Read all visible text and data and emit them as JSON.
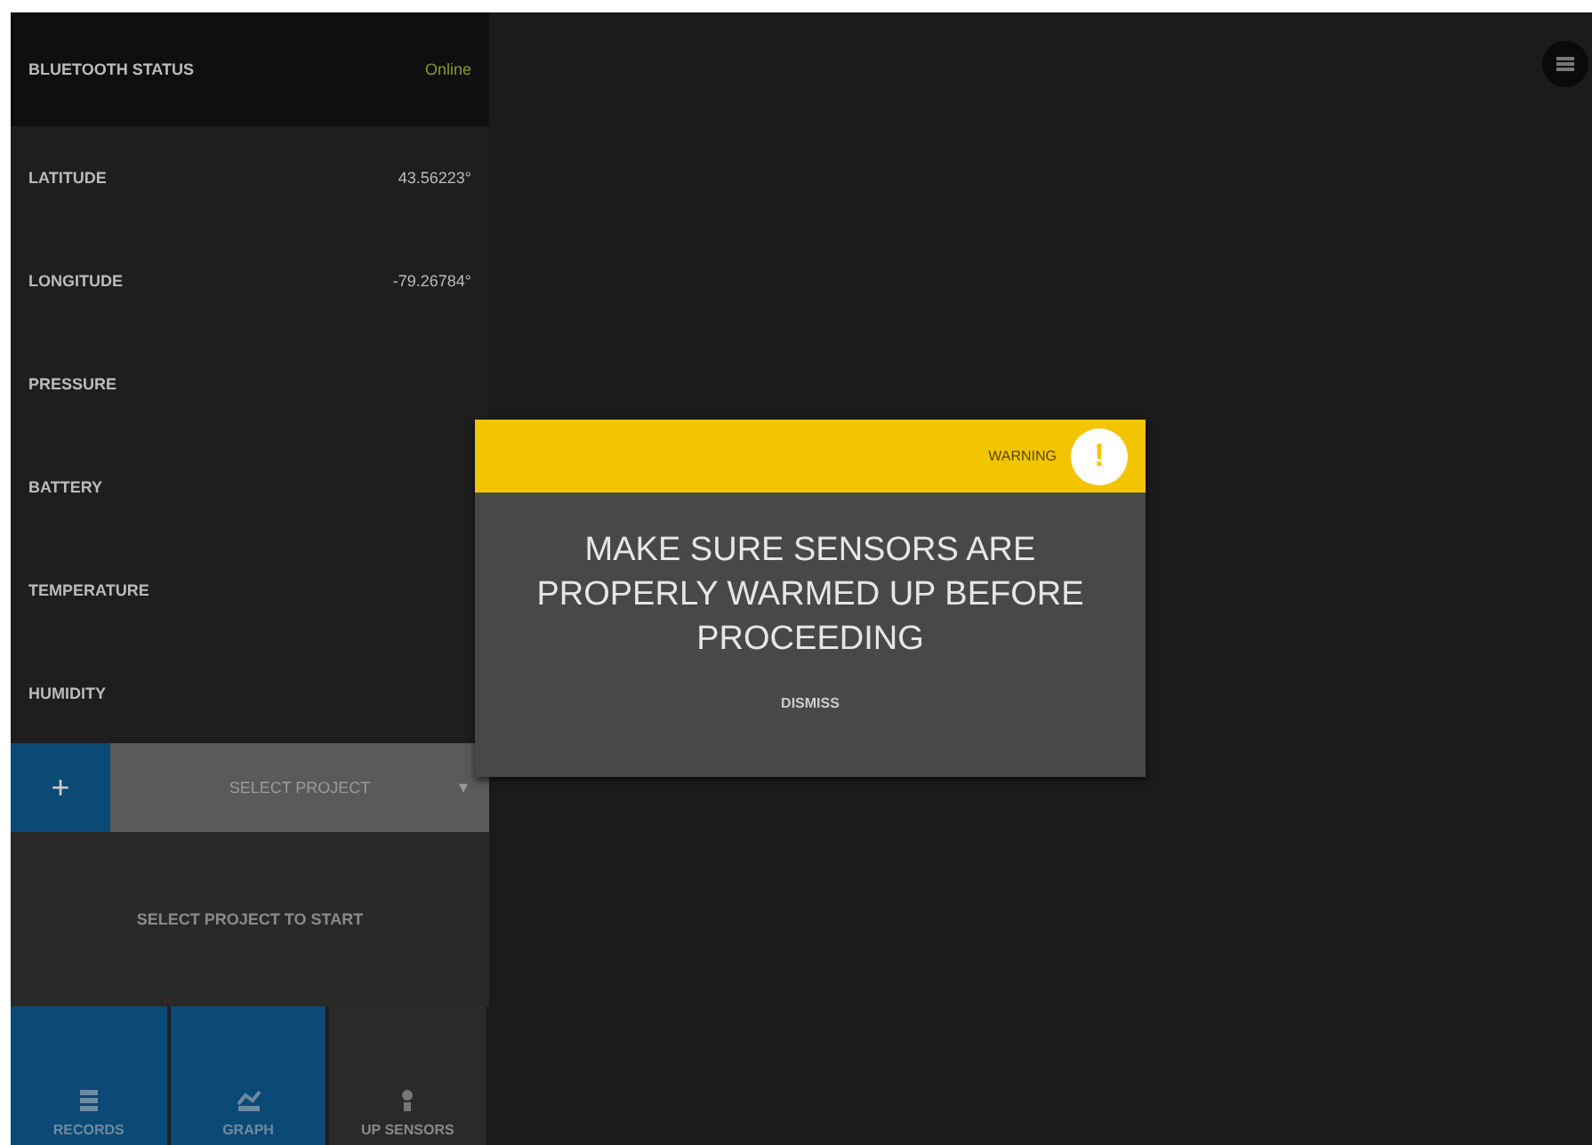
{
  "status": {
    "label": "BLUETOOTH STATUS",
    "value": "Online"
  },
  "readings": [
    {
      "label": "LATITUDE",
      "value": "43.56223°"
    },
    {
      "label": "LONGITUDE",
      "value": "-79.26784°"
    },
    {
      "label": "PRESSURE"
    },
    {
      "label": "BATTERY"
    },
    {
      "label": "TEMPERATURE"
    },
    {
      "label": "HUMIDITY"
    }
  ],
  "project": {
    "add": "+",
    "placeholder": "SELECT PROJECT",
    "caret": "▾"
  },
  "empty_message": "SELECT PROJECT TO START",
  "nav": [
    {
      "label": "RECORDS",
      "kind": "records",
      "selected": true
    },
    {
      "label": "GRAPH",
      "kind": "graph",
      "selected": true
    },
    {
      "label": "UP SENSORS",
      "kind": "sensors",
      "selected": false
    }
  ],
  "dialog": {
    "header": "WARNING",
    "badge": "!",
    "message": "MAKE SURE SENSORS ARE PROPERLY WARMED UP BEFORE PROCEEDING",
    "action": "DISMISS"
  }
}
